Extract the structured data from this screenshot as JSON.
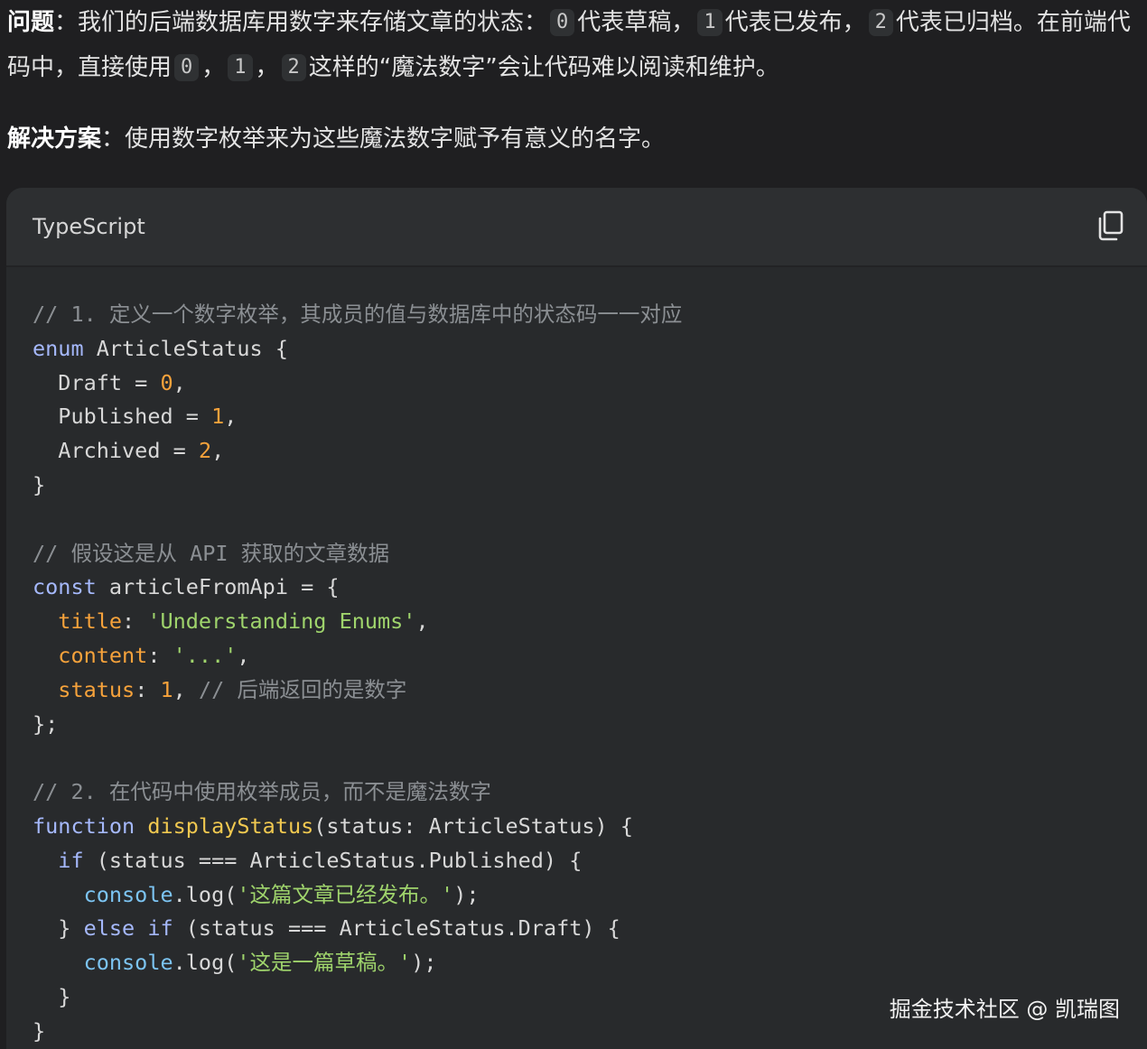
{
  "problem": {
    "label": "问题",
    "sep": "：",
    "t1": "我们的后端数据库用数字来存储文章的状态：",
    "chip0": "0",
    "t2": "代表草稿，",
    "chip1": "1",
    "t3": "代表已发布，",
    "chip2": "2",
    "t4": "代表已归档。在前端代码中，直接使用",
    "chip3": "0",
    "comma1": "，",
    "chip4": "1",
    "comma2": "，",
    "chip5": "2",
    "t5": "这样的“魔法数字”会让代码难以阅读和维护。"
  },
  "solution": {
    "label": "解决方案",
    "sep": "：",
    "text": "使用数字枚举来为这些魔法数字赋予有意义的名字。"
  },
  "code_block": {
    "language": "TypeScript",
    "copy_icon": "copy-icon",
    "lines": [
      [
        {
          "t": "// 1. 定义一个数字枚举，其成员的值与数据库中的状态码一一对应",
          "c": "cm"
        }
      ],
      [
        {
          "t": "enum",
          "c": "kw"
        },
        {
          "t": " ArticleStatus {",
          "c": "pl"
        }
      ],
      [
        {
          "t": "  Draft = ",
          "c": "pl"
        },
        {
          "t": "0",
          "c": "num"
        },
        {
          "t": ",",
          "c": "pl"
        }
      ],
      [
        {
          "t": "  Published = ",
          "c": "pl"
        },
        {
          "t": "1",
          "c": "num"
        },
        {
          "t": ",",
          "c": "pl"
        }
      ],
      [
        {
          "t": "  Archived = ",
          "c": "pl"
        },
        {
          "t": "2",
          "c": "num"
        },
        {
          "t": ",",
          "c": "pl"
        }
      ],
      [
        {
          "t": "}",
          "c": "pl"
        }
      ],
      [],
      [
        {
          "t": "// 假设这是从 API 获取的文章数据",
          "c": "cm"
        }
      ],
      [
        {
          "t": "const",
          "c": "kw"
        },
        {
          "t": " articleFromApi = {",
          "c": "pl"
        }
      ],
      [
        {
          "t": "  ",
          "c": "pl"
        },
        {
          "t": "title",
          "c": "prop"
        },
        {
          "t": ": ",
          "c": "pl"
        },
        {
          "t": "'Understanding Enums'",
          "c": "str"
        },
        {
          "t": ",",
          "c": "pl"
        }
      ],
      [
        {
          "t": "  ",
          "c": "pl"
        },
        {
          "t": "content",
          "c": "prop"
        },
        {
          "t": ": ",
          "c": "pl"
        },
        {
          "t": "'...'",
          "c": "str"
        },
        {
          "t": ",",
          "c": "pl"
        }
      ],
      [
        {
          "t": "  ",
          "c": "pl"
        },
        {
          "t": "status",
          "c": "prop"
        },
        {
          "t": ": ",
          "c": "pl"
        },
        {
          "t": "1",
          "c": "num"
        },
        {
          "t": ", ",
          "c": "pl"
        },
        {
          "t": "// 后端返回的是数字",
          "c": "cm"
        }
      ],
      [
        {
          "t": "};",
          "c": "pl"
        }
      ],
      [],
      [
        {
          "t": "// 2. 在代码中使用枚举成员，而不是魔法数字",
          "c": "cm"
        }
      ],
      [
        {
          "t": "function",
          "c": "kw"
        },
        {
          "t": " ",
          "c": "pl"
        },
        {
          "t": "displayStatus",
          "c": "fn"
        },
        {
          "t": "(status: ArticleStatus) {",
          "c": "pl"
        }
      ],
      [
        {
          "t": "  ",
          "c": "pl"
        },
        {
          "t": "if",
          "c": "kw"
        },
        {
          "t": " (status === ArticleStatus.Published) {",
          "c": "pl"
        }
      ],
      [
        {
          "t": "    ",
          "c": "pl"
        },
        {
          "t": "console",
          "c": "obj"
        },
        {
          "t": ".log(",
          "c": "pl"
        },
        {
          "t": "'这篇文章已经发布。'",
          "c": "str"
        },
        {
          "t": ");",
          "c": "pl"
        }
      ],
      [
        {
          "t": "  } ",
          "c": "pl"
        },
        {
          "t": "else",
          "c": "kw"
        },
        {
          "t": " ",
          "c": "pl"
        },
        {
          "t": "if",
          "c": "kw"
        },
        {
          "t": " (status === ArticleStatus.Draft) {",
          "c": "pl"
        }
      ],
      [
        {
          "t": "    ",
          "c": "pl"
        },
        {
          "t": "console",
          "c": "obj"
        },
        {
          "t": ".log(",
          "c": "pl"
        },
        {
          "t": "'这是一篇草稿。'",
          "c": "str"
        },
        {
          "t": ");",
          "c": "pl"
        }
      ],
      [
        {
          "t": "  }",
          "c": "pl"
        }
      ],
      [
        {
          "t": "}",
          "c": "pl"
        }
      ]
    ]
  },
  "watermark": "掘金技术社区 @ 凯瑞图",
  "colors": {
    "page_bg": "#1f1f21",
    "code_bg": "#282a2c",
    "header_bg": "#2d2f31",
    "comment": "#8b8f93",
    "keyword": "#a5b8fb",
    "number": "#f6a23b",
    "string": "#9fd46c",
    "function": "#f0c850",
    "object": "#7cc4f2"
  }
}
